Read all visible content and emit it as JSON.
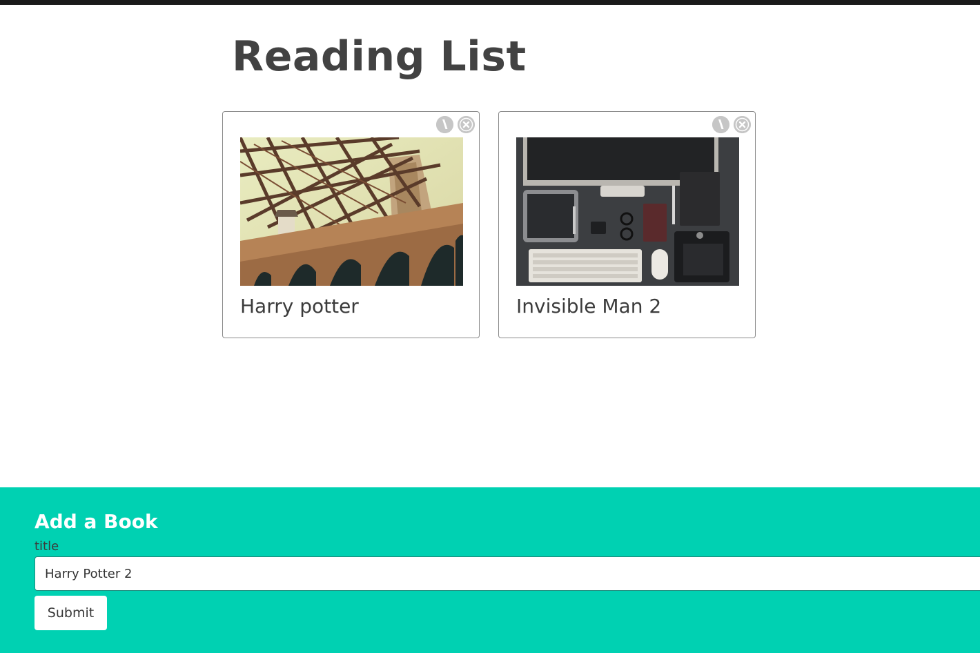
{
  "page": {
    "title": "Reading List"
  },
  "books": [
    {
      "title": "Harry potter",
      "image": "bridge-photo",
      "edit_icon": "pencil-icon",
      "delete_icon": "close-icon"
    },
    {
      "title": "Invisible Man 2",
      "image": "desk-gadgets-photo",
      "edit_icon": "pencil-icon",
      "delete_icon": "close-icon"
    }
  ],
  "form": {
    "heading": "Add a Book",
    "title_label": "title",
    "title_value": "Harry Potter 2",
    "submit_label": "Submit"
  },
  "colors": {
    "accent": "#00d1b2",
    "title_text": "#424242",
    "icon_bg": "#c6c6c6"
  }
}
